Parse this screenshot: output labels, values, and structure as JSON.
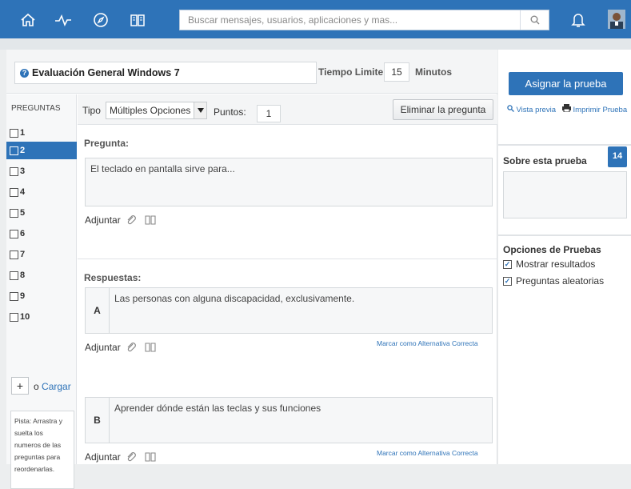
{
  "topbar": {
    "icons": [
      "home-icon",
      "activity-icon",
      "compass-icon",
      "book-icon"
    ],
    "search_placeholder": "Buscar mensajes, usuarios, aplicaciones y mas...",
    "color": "#2e73b8"
  },
  "header": {
    "title": "Evaluación General Windows 7",
    "time_label": "Tiempo Limite:",
    "time_value": "15",
    "time_unit": "Minutos"
  },
  "questions_panel": {
    "heading": "PREGUNTAS",
    "items": [
      "1",
      "2",
      "3",
      "4",
      "5",
      "6",
      "7",
      "8",
      "9",
      "10"
    ],
    "selected": "2",
    "add_label": "+",
    "or_text": "o",
    "load_link": "Cargar",
    "hint": "Pista: Arrastra y suelta los numeros de las preguntas para reordenarlas."
  },
  "question": {
    "type_label": "Tipo",
    "type_value": "Múltiples Opciones",
    "points_label": "Puntos:",
    "points_value": "1",
    "delete_button": "Eliminar la pregunta",
    "question_label": "Pregunta:",
    "question_text": "El teclado en pantalla sirve para...",
    "attach_label": "Adjuntar",
    "answers_label": "Respuestas:",
    "answers": [
      {
        "letter": "A",
        "text": "Las personas con alguna discapacidad, exclusivamente.",
        "attach": "Adjuntar",
        "mark": "Marcar como Alternativa Correcta"
      },
      {
        "letter": "B",
        "text": "Aprender dónde están las teclas y sus funciones",
        "attach": "Adjuntar",
        "mark": "Marcar como Alternativa Correcta"
      }
    ]
  },
  "sidebar": {
    "assign_button": "Asignar la prueba",
    "preview_link": "Vista previa",
    "print_link": "Imprimir Prueba",
    "about_label": "Sobre esta prueba",
    "about_badge": "14",
    "options_title": "Opciones de Pruebas",
    "options": [
      {
        "label": "Mostrar resultados",
        "checked": true
      },
      {
        "label": "Preguntas aleatorias",
        "checked": true
      }
    ]
  }
}
